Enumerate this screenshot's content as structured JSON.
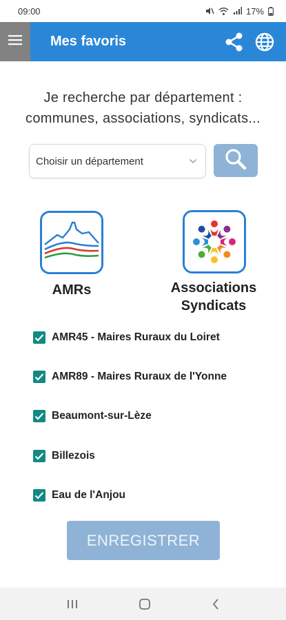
{
  "status_bar": {
    "time": "09:00",
    "battery": "17%",
    "icons": [
      "mute-icon",
      "wifi-icon",
      "signal-icon",
      "battery-icon"
    ]
  },
  "app_bar": {
    "title": "Mes favoris",
    "background": "#2a87d8",
    "icons": [
      "menu-icon",
      "share-icon",
      "globe-icon"
    ]
  },
  "intro": {
    "line1": "Je recherche par département :",
    "line2": "communes, associations, syndicats..."
  },
  "search": {
    "select_value": "Choisir un département",
    "icon": "search-icon"
  },
  "categories": {
    "amr_label": "AMRs",
    "asso_label_line1": "Associations",
    "asso_label_line2": "Syndicats"
  },
  "favorites": [
    {
      "label": "AMR45 - Maires Ruraux du Loiret",
      "checked": true
    },
    {
      "label": "AMR89 - Maires Ruraux de l'Yonne",
      "checked": true
    },
    {
      "label": "Beaumont-sur-Lèze",
      "checked": true
    },
    {
      "label": "Billezois",
      "checked": true
    },
    {
      "label": "Eau de l'Anjou",
      "checked": true
    }
  ],
  "colors": {
    "checkbox": "#118a82",
    "button_disabled": "#8fb3d6",
    "tile_border": "#2a7fd4"
  },
  "save_label": "ENREGISTRER",
  "nav_bar": {
    "icons": [
      "recent-apps-icon",
      "home-icon",
      "back-icon"
    ]
  }
}
